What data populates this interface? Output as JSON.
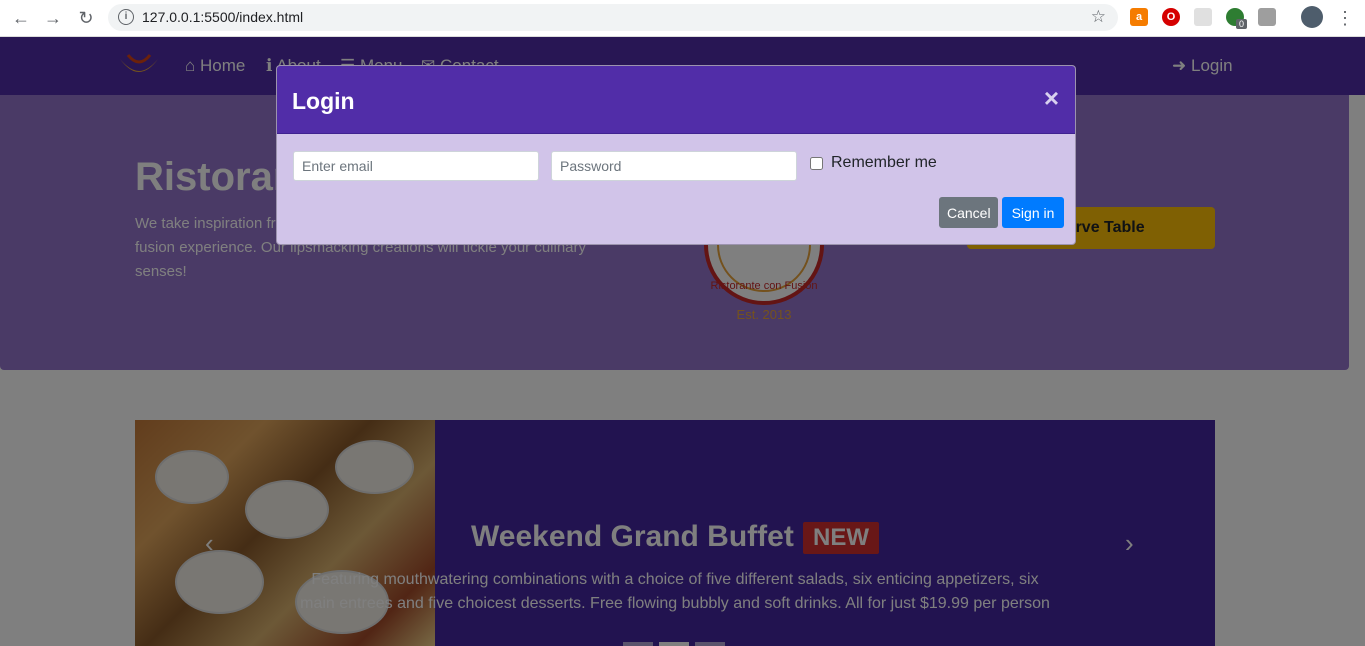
{
  "browser": {
    "url": "127.0.0.1:5500/index.html",
    "back_icon": "←",
    "forward_icon": "→",
    "reload_icon": "↻",
    "info_icon": "i",
    "star_icon": "☆",
    "menu_icon": "⋮",
    "ext_badge": "0"
  },
  "navbar": {
    "items": [
      {
        "label": "Home",
        "icon": "⌂"
      },
      {
        "label": "About",
        "icon": "ℹ"
      },
      {
        "label": "Menu",
        "icon": "☰"
      },
      {
        "label": "Contact",
        "icon": "✉"
      }
    ],
    "login_label": "Login",
    "login_icon": "➜"
  },
  "jumbotron": {
    "title": "Ristorante con Fusion",
    "description": "We take inspiration from the World's best cuisines, and create a unique fusion experience. Our lipsmacking creations will tickle your culinary senses!",
    "seal_text": "Ristorante con Fusion",
    "seal_est": "Est. 2013",
    "reserve_label": "Reserve Table"
  },
  "carousel": {
    "title": "Weekend Grand Buffet",
    "badge": "NEW",
    "description": "Featuring mouthwatering combinations with a choice of five different salads, six enticing appetizers, six main entrees and five choicest desserts. Free flowing bubbly and soft drinks. All for just $19.99 per person",
    "prev_icon": "‹",
    "next_icon": "›"
  },
  "modal": {
    "title": "Login",
    "close_icon": "×",
    "email_placeholder": "Enter email",
    "password_placeholder": "Password",
    "remember_label": "Remember me",
    "cancel_label": "Cancel",
    "signin_label": "Sign in"
  },
  "colors": {
    "primary": "#512da8",
    "modal_body": "#d1c4e9",
    "cancel": "#6c757d",
    "signin": "#007bff",
    "reserve": "#ffc107",
    "badge": "#d32f2f"
  }
}
